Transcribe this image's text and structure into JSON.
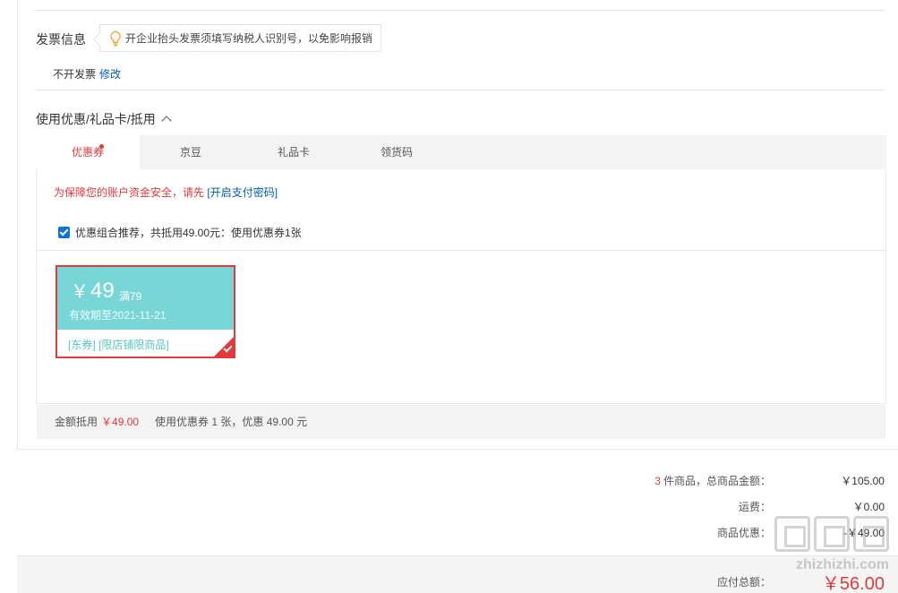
{
  "invoice": {
    "title": "发票信息",
    "tip": "开企业抬头发票须填写纳税人识别号，以免影响报销",
    "value": "不开发票",
    "edit_label": "修改"
  },
  "discount": {
    "title": "使用优惠/礼品卡/抵用",
    "tabs": [
      {
        "label": "优惠券",
        "active": true
      },
      {
        "label": "京豆"
      },
      {
        "label": "礼品卡"
      },
      {
        "label": "领货码"
      }
    ],
    "warning": "为保障您的账户资金安全，请先",
    "warning_link": "[开启支付密码]",
    "combo_text": "优惠组合推荐，共抵用49.00元：使用优惠券1张",
    "combo_checked": true,
    "coupon": {
      "currency": "￥",
      "amount": "49",
      "condition": "满79",
      "expiry": "有效期至2021-11-21",
      "tags": "[东券]  [限店铺限商品]",
      "selected": true
    },
    "summary_label": "金额抵用",
    "summary_amount": "￥49.00",
    "summary_detail": "使用优惠券 1 张，优惠 49.00 元"
  },
  "totals": {
    "count": "3",
    "goods_label": "件商品，总商品金额：",
    "goods_value": "￥105.00",
    "shipping_label": "运费：",
    "shipping_value": "￥0.00",
    "promo_label": "商品优惠：",
    "promo_value": "-￥49.00",
    "payable_label": "应付总额：",
    "payable_value": "￥56.00"
  },
  "colors": {
    "accent_red": "#e4393c",
    "link_blue": "#005ea7",
    "coupon_teal": "#79d6d6"
  },
  "watermark": {
    "text": "zhizhizhi.com"
  }
}
